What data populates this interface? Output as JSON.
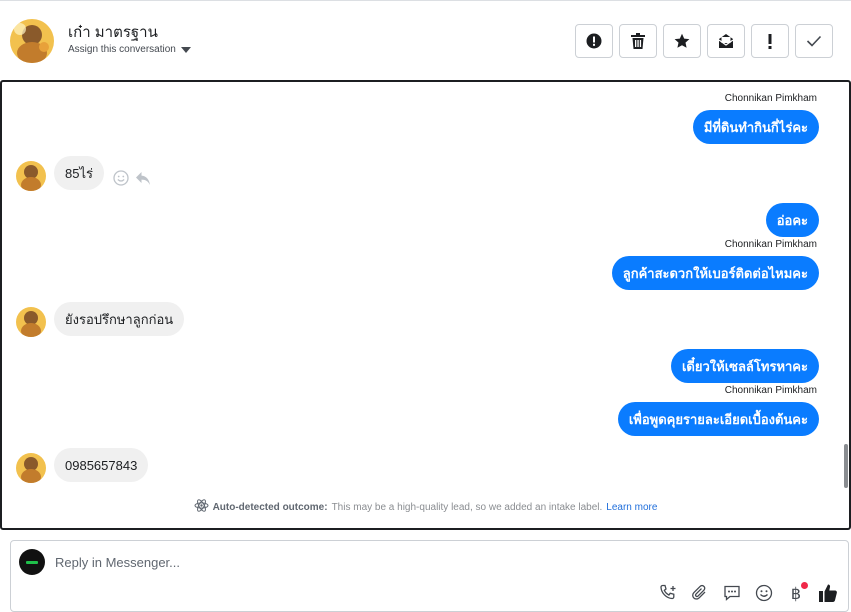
{
  "header": {
    "contact_name": "เก๋า มาตรฐาน",
    "assign_label": "Assign this conversation",
    "actions": [
      {
        "name": "mark-spam-button",
        "icon": "exclamation-circle-icon"
      },
      {
        "name": "delete-button",
        "icon": "trash-icon"
      },
      {
        "name": "star-button",
        "icon": "star-icon"
      },
      {
        "name": "mark-unread-button",
        "icon": "envelope-open-icon"
      },
      {
        "name": "follow-up-button",
        "icon": "exclamation-icon"
      },
      {
        "name": "mark-done-button",
        "icon": "checkmark-icon"
      }
    ]
  },
  "conversation": {
    "messages": [
      {
        "direction": "out",
        "sender": "Chonnikan Pimkham",
        "text": "มีที่ดินทำกินกี่ไร่คะ"
      },
      {
        "direction": "in",
        "text": "85ไร่"
      },
      {
        "direction": "out",
        "text": "อ่อคะ"
      },
      {
        "direction": "out",
        "sender": "Chonnikan Pimkham",
        "text": "ลูกค้าสะดวกให้เบอร์ติดต่อไหมคะ"
      },
      {
        "direction": "in",
        "text": "ยังรอปรึกษาลูกก่อน"
      },
      {
        "direction": "out",
        "text": "เดี๋ยวให้เซลล์โทรหาคะ"
      },
      {
        "direction": "out",
        "sender": "Chonnikan Pimkham",
        "text": "เพื่อพูดคุยรายละเอียดเบื้องต้นคะ"
      },
      {
        "direction": "in",
        "text": "0985657843"
      }
    ],
    "outcome": {
      "label": "Auto-detected outcome:",
      "text": "This may be a high-quality lead, so we added an intake label.",
      "link": "Learn more"
    }
  },
  "composer": {
    "placeholder": "Reply in Messenger...",
    "tools": [
      "phone-plus-icon",
      "paperclip-icon",
      "chat-bubble-icon",
      "smiley-icon",
      "baht-icon",
      "thumbs-up-icon"
    ],
    "baht_symbol": "฿",
    "notification_color": "#f02849"
  },
  "colors": {
    "outgoing_bubble": "#0a7cff",
    "incoming_bubble": "#f0f0f0",
    "link": "#216fdb"
  }
}
